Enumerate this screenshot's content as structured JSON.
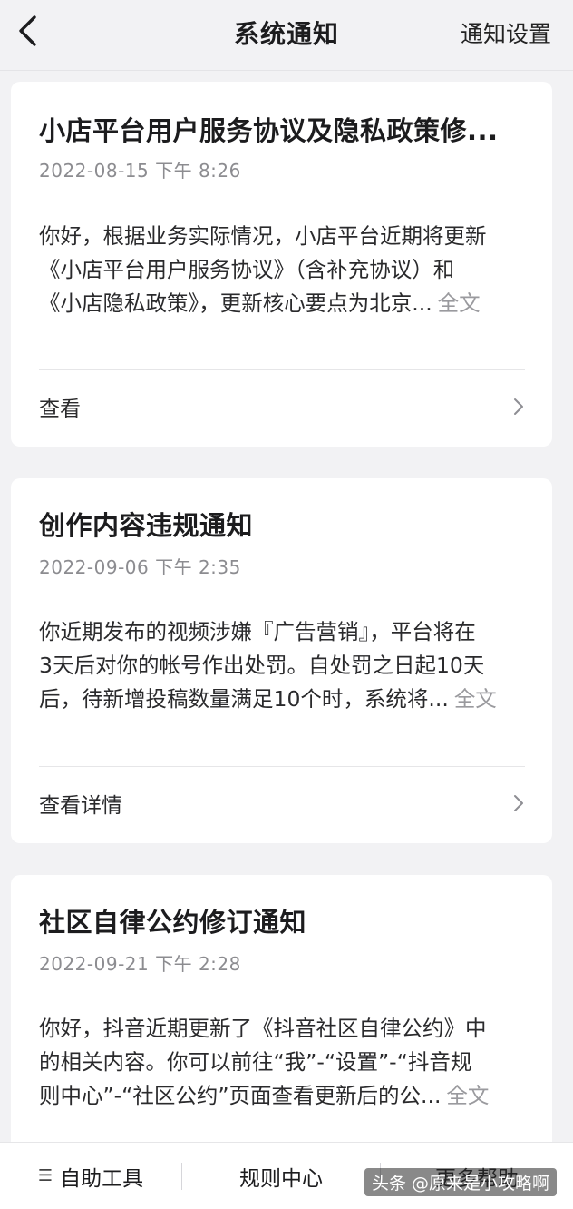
{
  "nav": {
    "title": "系统通知",
    "settings_label": "通知设置"
  },
  "notifications": [
    {
      "title": "小店平台用户服务协议及隐私政策修...",
      "time": "2022-08-15 下午 8:26",
      "body_lines": [
        "你好，根据业务实际情况，小店平台近期将更新",
        "《小店平台用户服务协议》（含补充协议）和",
        "《小店隐私政策》，更新核心要点为北京..."
      ],
      "more_label": "全文",
      "action_label": "查看"
    },
    {
      "title": "创作内容违规通知",
      "time": "2022-09-06 下午 2:35",
      "body_lines": [
        "你近期发布的视频涉嫌『广告营销』，平台将在",
        "3天后对你的帐号作出处罚。自处罚之日起10天",
        "后，待新增投稿数量满足10个时，系统将..."
      ],
      "more_label": "全文",
      "action_label": "查看详情"
    },
    {
      "title": "社区自律公约修订通知",
      "time": "2022-09-21 下午 2:28",
      "body_lines": [
        "你好，抖音近期更新了《抖音社区自律公约》中",
        "的相关内容。你可以前往“我”-“设置”-“抖音规",
        "则中心”-“社区公约”页面查看更新后的公..."
      ],
      "more_label": "全文"
    }
  ],
  "bottom_bar": {
    "self_help": "自助工具",
    "rules_center": "规则中心",
    "more_help": "更多帮助"
  },
  "watermark": "头条 @原来是小攻略啊"
}
